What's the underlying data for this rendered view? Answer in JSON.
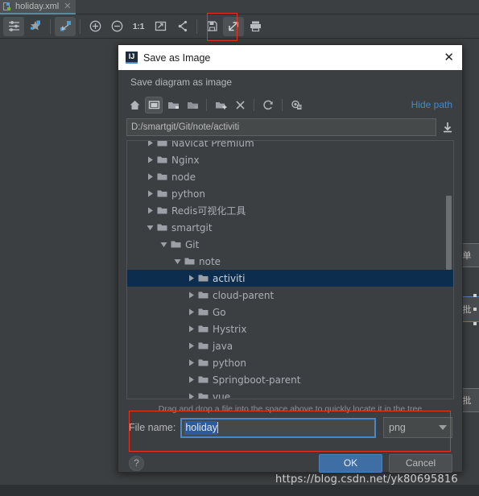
{
  "ide": {
    "tab": {
      "label": "holiday.xml",
      "icon": "xml-file-icon",
      "close_icon": "close-icon"
    },
    "toolbar": [
      {
        "name": "layout-settings-icon",
        "selected": true
      },
      {
        "name": "magic-layout-icon",
        "selected": false
      },
      {
        "name": "fit-content-icon",
        "selected": true
      },
      {
        "name": "zoom-in-icon",
        "selected": false
      },
      {
        "name": "zoom-out-icon",
        "selected": false
      },
      {
        "name": "actual-size-icon",
        "label": "1:1",
        "selected": false
      },
      {
        "name": "fit-screen-icon",
        "selected": false
      },
      {
        "name": "show-dependencies-icon",
        "selected": false
      },
      {
        "name": "save-icon",
        "selected": false
      },
      {
        "name": "export-to-image-icon",
        "selected": true
      },
      {
        "name": "print-icon",
        "selected": false
      }
    ],
    "diagram_nodes": [
      {
        "label": "单",
        "selected": false
      },
      {
        "label": "批",
        "selected": true
      },
      {
        "label": "批",
        "selected": false
      }
    ]
  },
  "dialog": {
    "title": "Save as Image",
    "app_icon": "IJ",
    "close_icon": "close-icon",
    "subtitle": "Save diagram as image",
    "toolbar": [
      {
        "name": "home-icon",
        "selected": false
      },
      {
        "name": "desktop-icon",
        "selected": true
      },
      {
        "name": "project-folder-icon",
        "selected": false
      },
      {
        "name": "module-folder-icon",
        "selected": false
      },
      {
        "name": "new-folder-icon",
        "selected": false
      },
      {
        "name": "delete-icon",
        "selected": false
      },
      {
        "name": "refresh-icon",
        "selected": false
      },
      {
        "name": "show-hidden-files-icon",
        "selected": false
      }
    ],
    "hide_path_label": "Hide path",
    "path": {
      "value": "D:/smartgit/Git/note/activiti",
      "download_icon": "download-icon"
    },
    "tree": [
      {
        "label": "Navicat Premium",
        "indent": 0,
        "state": "collapsed",
        "selected": false,
        "clipped": true
      },
      {
        "label": "Nginx",
        "indent": 0,
        "state": "collapsed",
        "selected": false
      },
      {
        "label": "node",
        "indent": 0,
        "state": "collapsed",
        "selected": false
      },
      {
        "label": "python",
        "indent": 0,
        "state": "collapsed",
        "selected": false
      },
      {
        "label": "Redis可视化工具",
        "indent": 0,
        "state": "collapsed",
        "selected": false
      },
      {
        "label": "smartgit",
        "indent": 0,
        "state": "expanded",
        "selected": false
      },
      {
        "label": "Git",
        "indent": 1,
        "state": "expanded",
        "selected": false
      },
      {
        "label": "note",
        "indent": 2,
        "state": "expanded",
        "selected": false
      },
      {
        "label": "activiti",
        "indent": 3,
        "state": "collapsed",
        "selected": true
      },
      {
        "label": "cloud-parent",
        "indent": 3,
        "state": "collapsed",
        "selected": false
      },
      {
        "label": "Go",
        "indent": 3,
        "state": "collapsed",
        "selected": false
      },
      {
        "label": "Hystrix",
        "indent": 3,
        "state": "collapsed",
        "selected": false
      },
      {
        "label": "java",
        "indent": 3,
        "state": "collapsed",
        "selected": false
      },
      {
        "label": "python",
        "indent": 3,
        "state": "collapsed",
        "selected": false
      },
      {
        "label": "Springboot-parent",
        "indent": 3,
        "state": "collapsed",
        "selected": false
      },
      {
        "label": "vue",
        "indent": 3,
        "state": "collapsed",
        "selected": false
      }
    ],
    "hint": "Drag and drop a file into the space above to quickly locate it in the tree",
    "file_name": {
      "label": "File name:",
      "value": "holiday",
      "selected": true
    },
    "extension": {
      "value": "png",
      "arrow_icon": "chevron-down-icon"
    },
    "help_label": "?",
    "ok_label": "OK",
    "cancel_label": "Cancel"
  },
  "watermark": "https://blog.csdn.net/yk80695816",
  "colors": {
    "accent_blue": "#4a86c8",
    "selection_blue": "#0d2d4e",
    "annotation_red": "#ee3124",
    "primary_button": "#3f6ea5",
    "panel_bg": "#3c3f41"
  }
}
